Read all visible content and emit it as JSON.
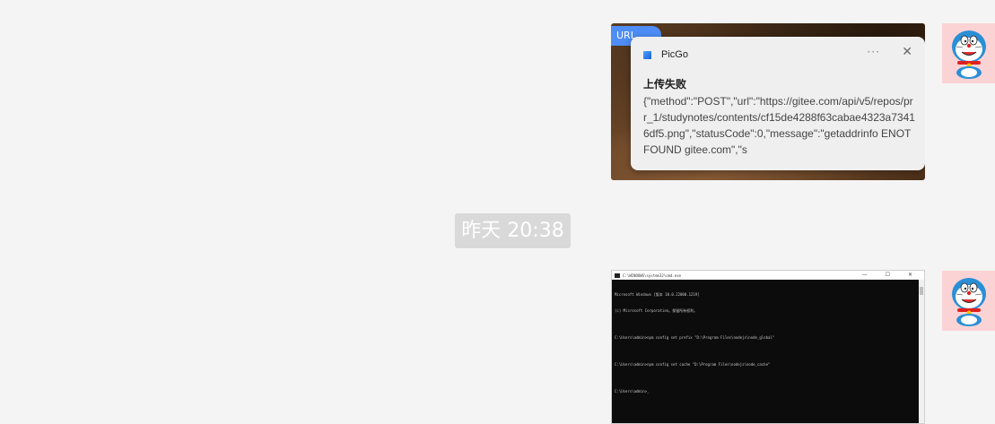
{
  "messages": [
    {
      "type": "image",
      "content": {
        "url_chip": "URL",
        "app_name": "PicGo",
        "more": "···",
        "close": "✕",
        "title": "上传失败",
        "body": "{\"method\":\"POST\",\"url\":\"https://gitee.com/api/v5/repos/prr_1/studynotes/contents/cf15de4288f63cabae4323a73416df5.png\",\"statusCode\":0,\"message\":\"getaddrinfo ENOTFOUND gitee.com\",\"s"
      }
    },
    {
      "type": "image",
      "content": {
        "window_title": "C:\\WINDOWS\\system32\\cmd.exe",
        "window_controls": "—  ☐  ✕",
        "lines": [
          "Microsoft Windows [版本 10.0.22000.1219]",
          "(c) Microsoft Corporation。保留所有权利。",
          "",
          "C:\\Users\\admin>npm config set prefix \"D:\\Program Files\\nodejs\\node_global\"",
          "",
          "C:\\Users\\admin>npm config set cache \"D:\\Program Files\\nodejs\\node_cache\"",
          "",
          "C:\\Users\\admin>_"
        ]
      }
    }
  ],
  "timestamp": "昨天 20:38",
  "avatar_icon": "doraemon-avatar-icon",
  "colors": {
    "background": "#f4f4f4",
    "avatar_bg": "#fbd3d5",
    "timestamp_bg": "#d9d9d9",
    "url_chip": "#4d8df5"
  }
}
